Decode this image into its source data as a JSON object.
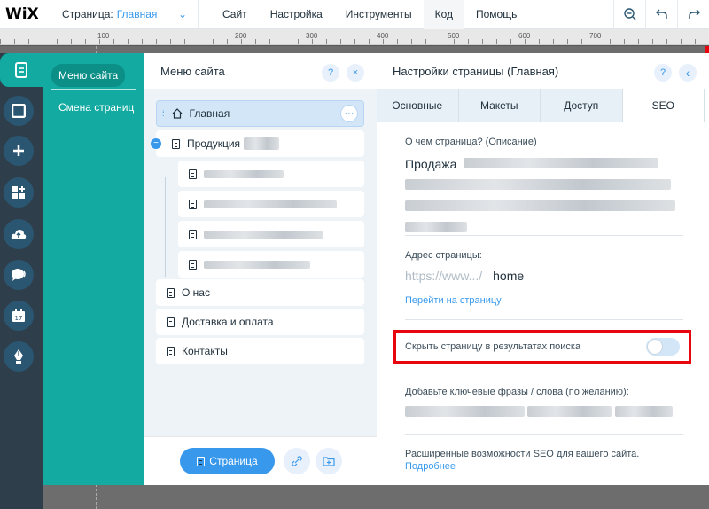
{
  "topbar": {
    "logo": "WiX",
    "page_label": "Страница:",
    "page_value": "Главная",
    "menu": [
      "Сайт",
      "Настройка",
      "Инструменты",
      "Код",
      "Помощь"
    ]
  },
  "ruler": {
    "labels": [
      "100",
      "200",
      "300",
      "400",
      "500",
      "600",
      "700"
    ]
  },
  "teal_panel": {
    "items": [
      "Меню сайта",
      "Смена страниц"
    ]
  },
  "pages_panel": {
    "title": "Меню сайта",
    "help": "?",
    "close": "×",
    "pages": [
      "Главная",
      "Продукция",
      "О нас",
      "Доставка и оплата",
      "Контакты"
    ],
    "add_page_label": "Страница"
  },
  "settings": {
    "title": "Настройки страницы (Главная)",
    "help": "?",
    "back": "‹",
    "tabs": [
      "Основные",
      "Макеты",
      "Доступ",
      "SEO"
    ],
    "description_label": "О чем страница? (Описание)",
    "description_value": "Продажа",
    "address_label": "Адрес страницы:",
    "url_prefix": "https://www.../",
    "url_slug": "home",
    "go_to_page": "Перейти на страницу",
    "hide_label": "Скрыть страницу в результатах поиска",
    "hide_enabled": false,
    "keywords_label": "Добавьте ключевые фразы / слова (по желанию):",
    "advanced_text": "Расширенные возможности SEO для вашего сайта.",
    "more_link": "Подробнее"
  },
  "colors": {
    "accent": "#3899ec",
    "teal": "#13aaa1",
    "sidebar": "#2e3f4b",
    "highlight": "#e8060e"
  }
}
